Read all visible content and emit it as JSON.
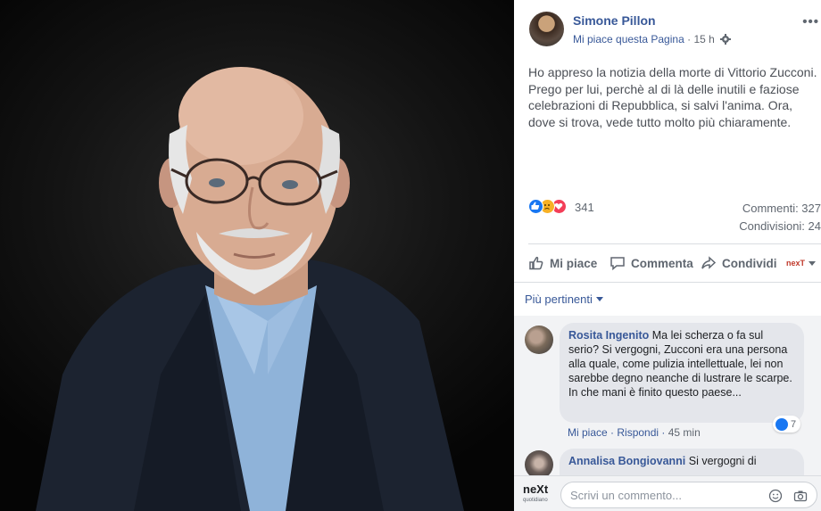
{
  "post": {
    "author": "Simone Pillon",
    "page_like": "Mi piace questa Pagina",
    "separator": "·",
    "time": "15 h",
    "text": "Ho appreso la notizia della morte di Vittorio Zucconi.\nPrego per lui, perchè al di là delle inutili e faziose\ncelebrazioni di Repubblica, si salvi l'anima. Ora,\ndove si trova, vede tutto molto più chiaramente.",
    "reaction_count": "341",
    "comments_stat": "Commenti: 327",
    "shares_stat": "Condivisioni: 24"
  },
  "actions": {
    "like": "Mi piace",
    "comment": "Commenta",
    "share": "Condividi",
    "page_logo": "nexT"
  },
  "filter": {
    "label": "Più pertinenti"
  },
  "comments": [
    {
      "name": "Rosita Ingenito",
      "text": "Ma lei scherza o fa sul serio? Si vergogni, Zucconi era una persona alla quale, come pulizia intellettuale, lei non sarebbe degno neanche di lustrare le scarpe.\nIn che mani è finito questo paese...",
      "likes": "7",
      "like_label": "Mi piace",
      "reply_label": "Rispondi",
      "time": "45 min"
    },
    {
      "name": "Annalisa Bongiovanni",
      "text": "Si vergogni di"
    }
  ],
  "composer": {
    "logo": "neXt",
    "logo_sub": "quotidiano",
    "placeholder": "Scrivi un commento..."
  },
  "colors": {
    "link": "#385898",
    "like_blue": "#1877f2",
    "panel_bg": "#ffffff",
    "comment_bg": "#f2f3f5"
  }
}
